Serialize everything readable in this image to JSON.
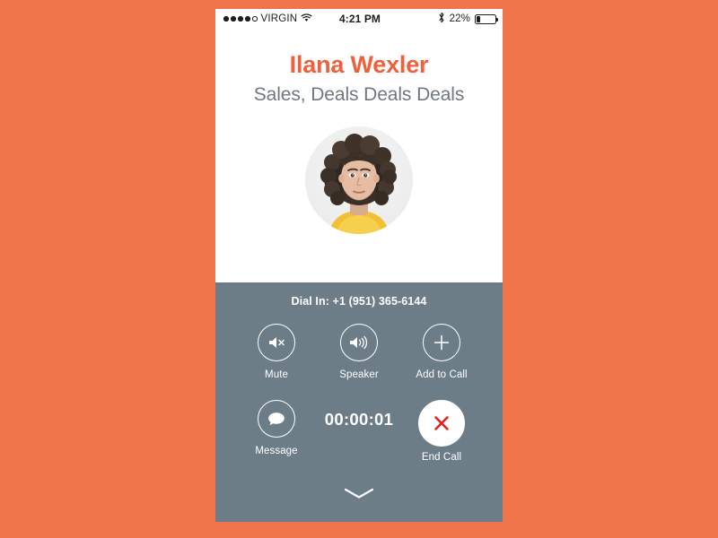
{
  "theme": {
    "background": "#ef7449",
    "panel_white": "#ffffff",
    "panel_gray": "#6d7d88",
    "accent_orange": "#ef603c",
    "subtitle_gray": "#6f7880",
    "end_call_red": "#e02020"
  },
  "status_bar": {
    "signal_dots_filled": 4,
    "signal_dots_total": 5,
    "carrier": "VIRGIN",
    "wifi_icon": "wifi-icon",
    "time": "4:21 PM",
    "bluetooth_icon": "bluetooth-icon",
    "battery_percent": "22%",
    "battery_fill": 22
  },
  "contact": {
    "name": "Ilana Wexler",
    "subtitle": "Sales, Deals Deals Deals",
    "avatar_icon": "avatar-photo"
  },
  "call": {
    "dial_in": "Dial In: +1 (951) 365-6144",
    "timer": "00:00:01",
    "controls_row1": [
      {
        "label": "Mute",
        "icon": "speaker-mute-icon"
      },
      {
        "label": "Speaker",
        "icon": "speaker-waves-icon"
      },
      {
        "label": "Add to Call",
        "icon": "plus-icon"
      }
    ],
    "controls_row2": [
      {
        "label": "Message",
        "icon": "message-bubble-icon"
      },
      {
        "label": "End Call",
        "icon": "close-x-icon"
      }
    ],
    "dismiss_icon": "chevron-down-icon"
  }
}
